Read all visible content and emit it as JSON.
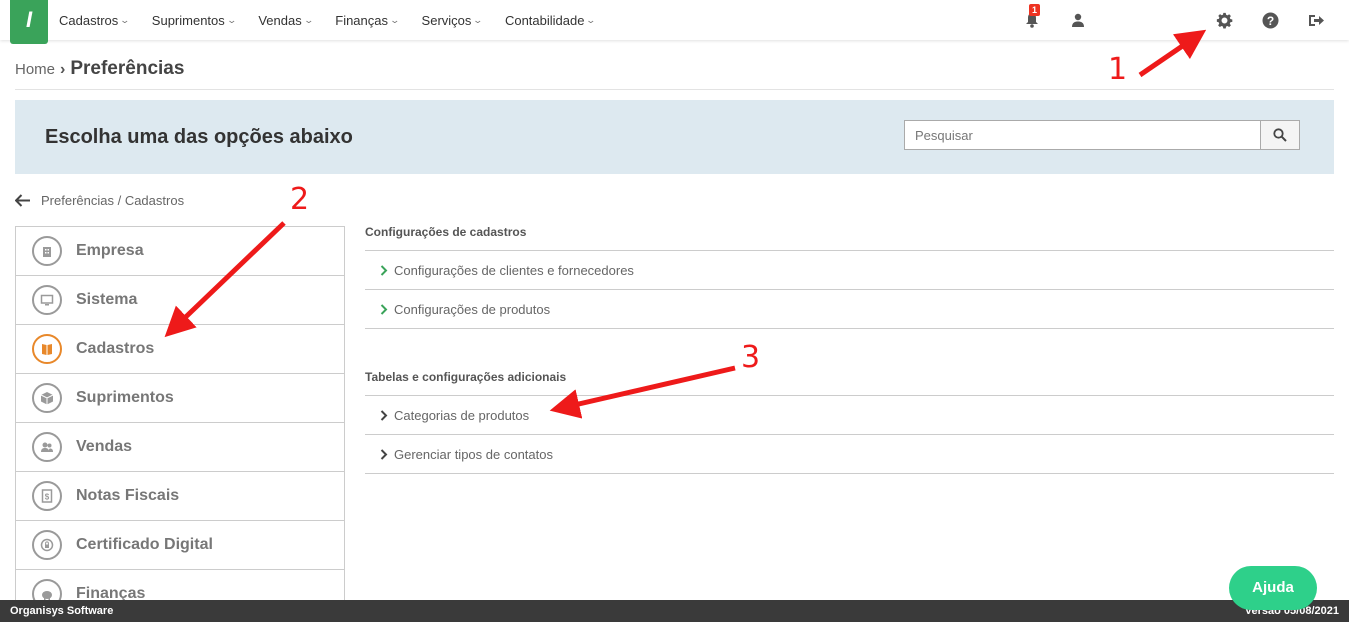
{
  "app": {
    "logo_text": "I",
    "brand_color": "#3aa35a"
  },
  "topnav": {
    "items": [
      {
        "label": "Cadastros"
      },
      {
        "label": "Suprimentos"
      },
      {
        "label": "Vendas"
      },
      {
        "label": "Finanças"
      },
      {
        "label": "Serviços"
      },
      {
        "label": "Contabilidade"
      }
    ],
    "notification_count": "1",
    "icons": [
      "bell-icon",
      "user-icon",
      "gear-icon",
      "help-icon",
      "logout-icon"
    ]
  },
  "breadcrumb": {
    "home": "Home",
    "current": "Preferências"
  },
  "hero": {
    "title": "Escolha uma das opções abaixo",
    "search_placeholder": "Pesquisar",
    "background": "#dde9f0"
  },
  "back": {
    "label": "Preferências / Cadastros"
  },
  "sidebar": {
    "items": [
      {
        "label": "Empresa",
        "icon": "building-icon"
      },
      {
        "label": "Sistema",
        "icon": "monitor-icon"
      },
      {
        "label": "Cadastros",
        "icon": "book-icon",
        "active": true
      },
      {
        "label": "Suprimentos",
        "icon": "box-icon"
      },
      {
        "label": "Vendas",
        "icon": "people-icon"
      },
      {
        "label": "Notas Fiscais",
        "icon": "receipt-icon"
      },
      {
        "label": "Certificado Digital",
        "icon": "certificate-icon"
      },
      {
        "label": "Finanças",
        "icon": "piggy-bank-icon"
      }
    ],
    "active_color": "#e8882a"
  },
  "content": {
    "sections": [
      {
        "title": "Configurações de cadastros",
        "links": [
          {
            "label": "Configurações de clientes e fornecedores"
          },
          {
            "label": "Configurações de produtos"
          }
        ]
      },
      {
        "title": "Tabelas e configurações adicionais",
        "links": [
          {
            "label": "Categorias de produtos"
          },
          {
            "label": "Gerenciar tipos de contatos"
          }
        ]
      }
    ]
  },
  "annotations": {
    "n1": "1",
    "n2": "2",
    "n3": "3",
    "color": "#ee1a1a"
  },
  "help_button": {
    "label": "Ajuda",
    "color": "#2ed08a"
  },
  "footer": {
    "left": "Organisys Software",
    "right": "Versão 05/08/2021"
  }
}
